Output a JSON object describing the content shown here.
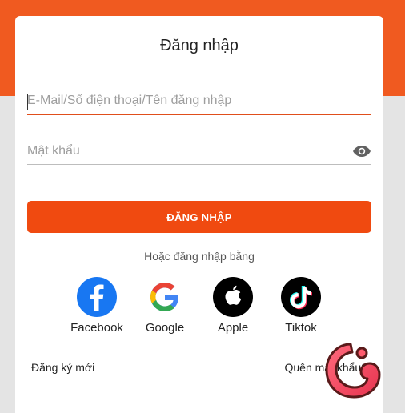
{
  "login": {
    "title": "Đăng nhập",
    "username_placeholder": "E-Mail/Số điện thoại/Tên đăng nhập",
    "username_value": "",
    "password_placeholder": "Mật khẩu",
    "password_value": "",
    "password_toggle_icon": "eye-icon",
    "submit_label": "ĐĂNG NHẬP",
    "or_text": "Hoặc đăng nhập bằng",
    "social": [
      {
        "label": "Facebook",
        "icon": "facebook-icon"
      },
      {
        "label": "Google",
        "icon": "google-icon"
      },
      {
        "label": "Apple",
        "icon": "apple-icon"
      },
      {
        "label": "Tiktok",
        "icon": "tiktok-icon"
      }
    ],
    "register_link": "Đăng ký mới",
    "forgot_link": "Quên mật khẩu?"
  },
  "colors": {
    "brand": "#f05a20",
    "button": "#f04a10",
    "active_underline": "#e04e1b"
  }
}
